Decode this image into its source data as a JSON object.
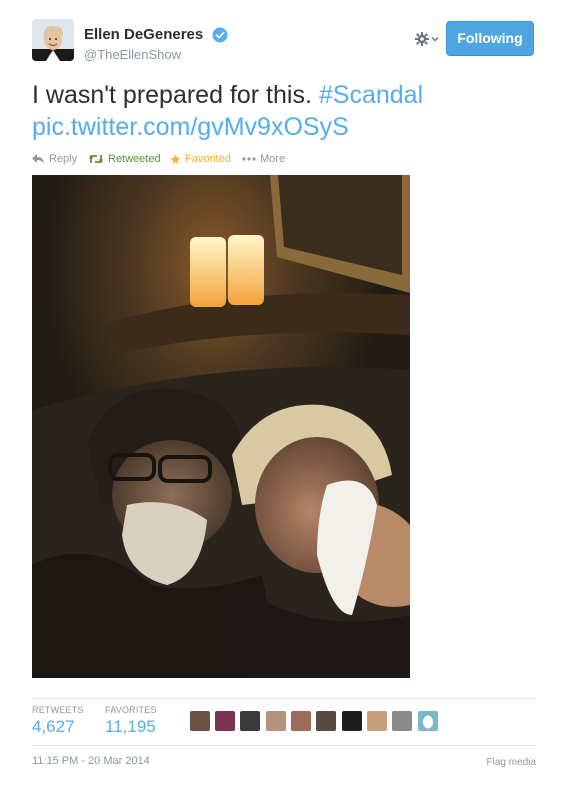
{
  "user": {
    "name": "Ellen DeGeneres",
    "handle": "@TheEllenShow",
    "verified_icon": "verified-badge-icon",
    "avatar_icon": "avatar-photo"
  },
  "controls": {
    "gear_icon": "gear-icon",
    "follow_label": "Following",
    "follow_color": "#4fa5e0"
  },
  "tweet": {
    "text": "I wasn't prepared for this.",
    "hashtag": "#Scandal",
    "link": "pic.twitter.com/gvMv9xOSyS",
    "link_color": "#55acee"
  },
  "actions": {
    "reply": "Reply",
    "retweet": "Retweeted",
    "favorite": "Favorited",
    "more": "More",
    "retweet_color": "#5c913b",
    "favorite_color": "#ffac33"
  },
  "stats": {
    "retweets_label": "RETWEETS",
    "retweets_value": "4,627",
    "favorites_label": "FAVORITES",
    "favorites_value": "11,195"
  },
  "footer": {
    "timestamp": "11:15 PM - 20 Mar 2014",
    "flag_media": "Flag media"
  }
}
